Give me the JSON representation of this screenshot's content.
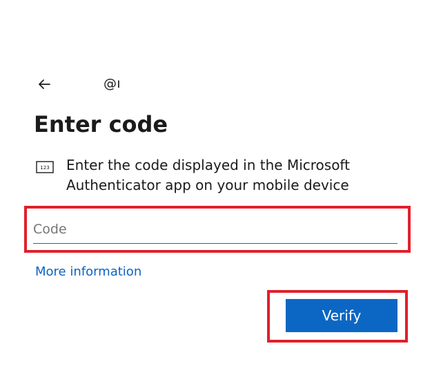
{
  "header": {
    "back_icon": "arrow-left-icon",
    "identity": "@ı"
  },
  "main": {
    "title": "Enter code",
    "instruction_icon": "numeric-code-icon",
    "instruction_icon_text": "123",
    "instruction": "Enter the code displayed in the Microsoft Authenticator app on your mobile device"
  },
  "code_field": {
    "value": "",
    "placeholder": "Code"
  },
  "links": {
    "more_information": "More information"
  },
  "actions": {
    "verify_label": "Verify"
  },
  "colors": {
    "accent": "#0C67C4",
    "link": "#0A63C5",
    "highlight": "#E0202B",
    "underline": "#1F6F8F"
  }
}
